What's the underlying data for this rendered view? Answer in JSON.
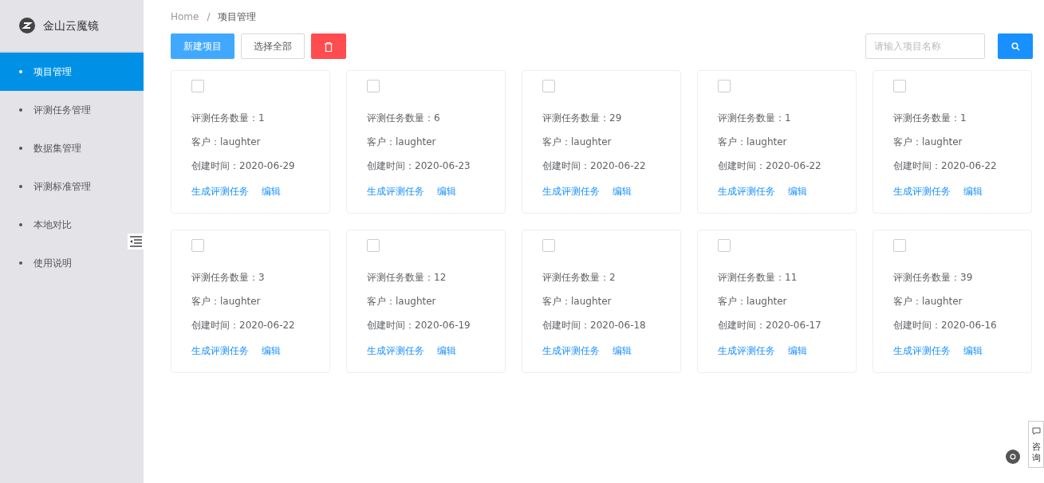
{
  "sidebar": {
    "brand": "金山云魔镜",
    "items": [
      {
        "label": "项目管理",
        "selected": true
      },
      {
        "label": "评测任务管理",
        "selected": false
      },
      {
        "label": "数据集管理",
        "selected": false
      },
      {
        "label": "评测标准管理",
        "selected": false
      },
      {
        "label": "本地对比",
        "selected": false
      },
      {
        "label": "使用说明",
        "selected": false
      }
    ]
  },
  "breadcrumb": [
    "Home",
    "项目管理"
  ],
  "breadcrumb_separator": "/",
  "toolbar": {
    "new_button": "新建项目",
    "select_all_button": "选择全部",
    "search": {
      "placeholder": "请输入项目名称"
    }
  },
  "projects": [
    {
      "checked": false,
      "task_count": "评测任务数量：1",
      "client": "客户：laughter",
      "created": "创建时间：2020-06-29",
      "actions": [
        "生成评测任务",
        "编辑"
      ]
    },
    {
      "checked": false,
      "task_count": "评测任务数量：6",
      "client": "客户：laughter",
      "created": "创建时间：2020-06-23",
      "actions": [
        "生成评测任务",
        "编辑"
      ]
    },
    {
      "checked": false,
      "task_count": "评测任务数量：29",
      "client": "客户：laughter",
      "created": "创建时间：2020-06-22",
      "actions": [
        "生成评测任务",
        "编辑"
      ]
    },
    {
      "checked": false,
      "task_count": "评测任务数量：1",
      "client": "客户：laughter",
      "created": "创建时间：2020-06-22",
      "actions": [
        "生成评测任务",
        "编辑"
      ]
    },
    {
      "checked": false,
      "task_count": "评测任务数量：1",
      "client": "客户：laughter",
      "created": "创建时间：2020-06-22",
      "actions": [
        "生成评测任务",
        "编辑"
      ]
    },
    {
      "checked": false,
      "task_count": "评测任务数量：3",
      "client": "客户：laughter",
      "created": "创建时间：2020-06-22",
      "actions": [
        "生成评测任务",
        "编辑"
      ]
    },
    {
      "checked": false,
      "task_count": "评测任务数量：12",
      "client": "客户：laughter",
      "created": "创建时间：2020-06-19",
      "actions": [
        "生成评测任务",
        "编辑"
      ]
    },
    {
      "checked": false,
      "task_count": "评测任务数量：2",
      "client": "客户：laughter",
      "created": "创建时间：2020-06-18",
      "actions": [
        "生成评测任务",
        "编辑"
      ]
    },
    {
      "checked": false,
      "task_count": "评测任务数量：11",
      "client": "客户：laughter",
      "created": "创建时间：2020-06-17",
      "actions": [
        "生成评测任务",
        "编辑"
      ]
    },
    {
      "checked": false,
      "task_count": "评测任务数量：39",
      "client": "客户：laughter",
      "created": "创建时间：2020-06-16",
      "actions": [
        "生成评测任务",
        "编辑"
      ]
    }
  ],
  "consult_tab": "咨询"
}
